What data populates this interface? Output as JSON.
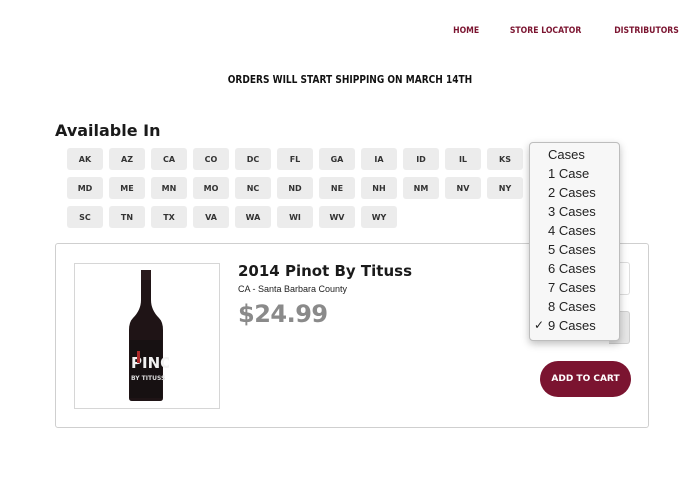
{
  "nav": [
    "HOME",
    "STORE LOCATOR",
    "DISTRIBUTORS"
  ],
  "banner": "ORDERS WILL START SHIPPING ON MARCH 14TH",
  "available_title": "Available In",
  "states": [
    [
      "AK",
      "AZ",
      "CA",
      "CO",
      "DC",
      "FL",
      "GA",
      "IA",
      "ID",
      "IL",
      "KS"
    ],
    [
      "MD",
      "ME",
      "MN",
      "MO",
      "NC",
      "ND",
      "NE",
      "NH",
      "NM",
      "NV",
      "NY"
    ],
    [
      "SC",
      "TN",
      "TX",
      "VA",
      "WA",
      "WI",
      "WV",
      "WY"
    ]
  ],
  "product": {
    "name": "2014 Pinot By Tituss",
    "region": "CA - Santa Barbara County",
    "price": "$24.99",
    "bottle_label_big": "PINO",
    "bottle_label_small": "BY TITUSS",
    "add_to_cart": "ADD TO CART"
  },
  "dropdown": {
    "options": [
      "Cases",
      "1 Case",
      "2 Cases",
      "3 Cases",
      "4 Cases",
      "5 Cases",
      "6 Cases",
      "7 Cases",
      "8 Cases",
      "9 Cases"
    ],
    "selected": "9 Cases"
  },
  "colors": {
    "brand": "#7b1430",
    "tag_bg": "#ececec",
    "price": "#8a8a8a"
  }
}
